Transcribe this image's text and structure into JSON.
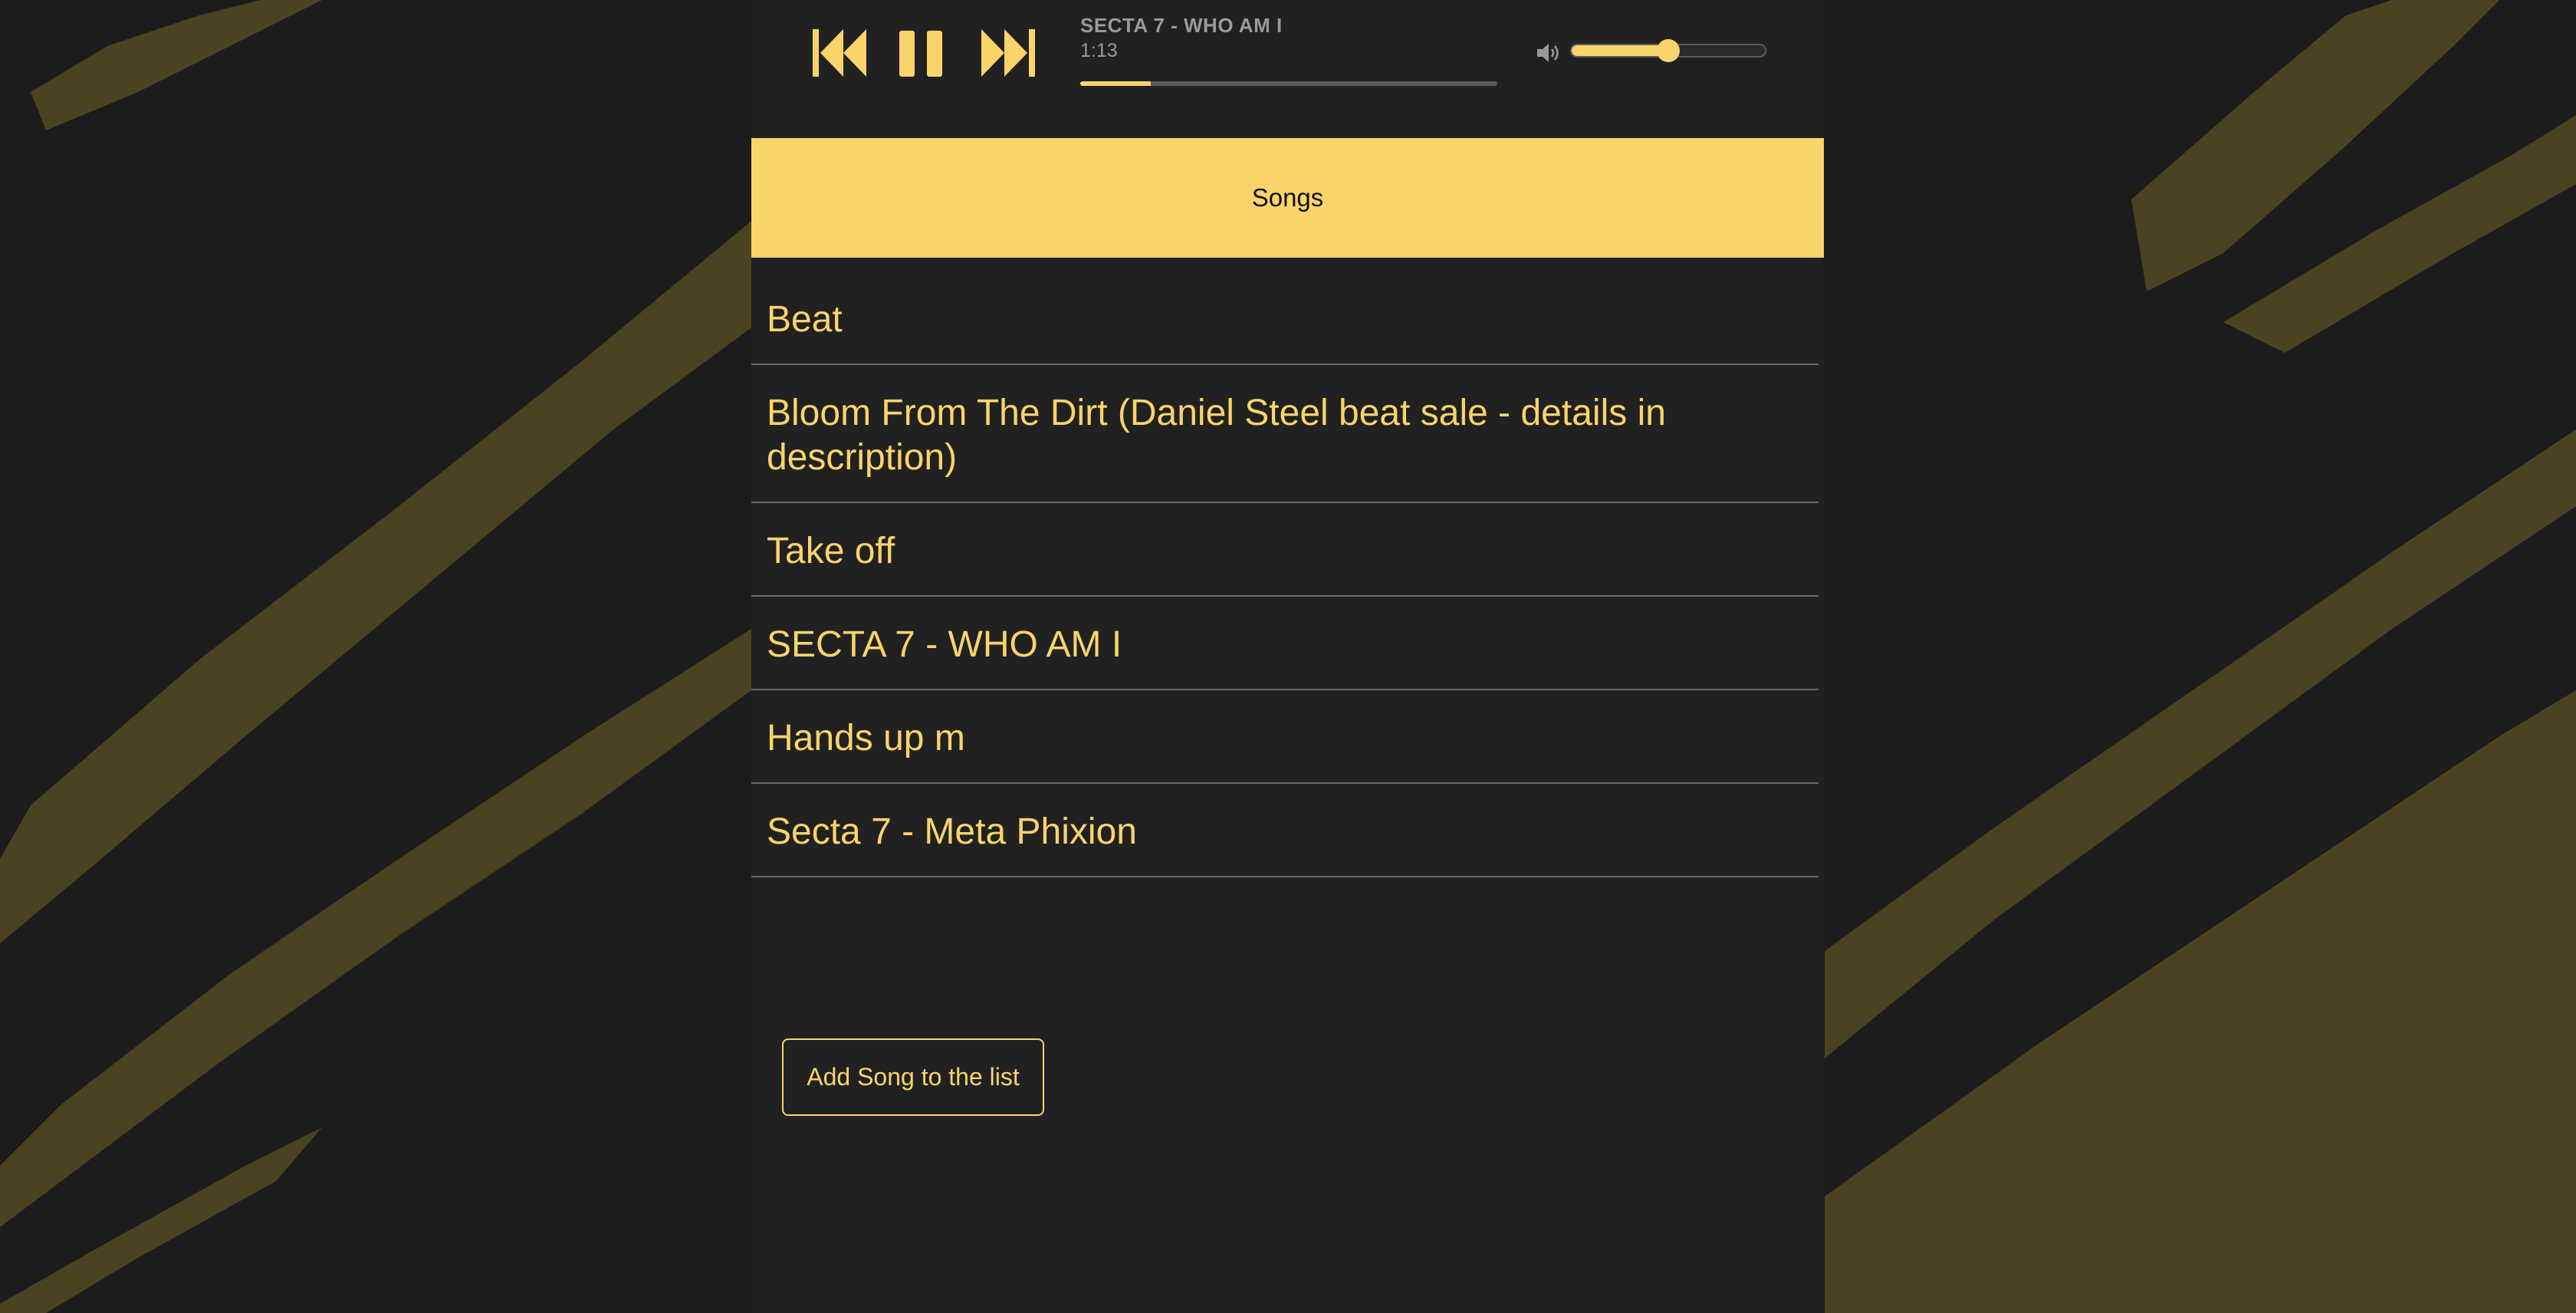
{
  "colors": {
    "accent": "#f9d46b",
    "panel_bg": "#212121",
    "page_bg": "#1f1f1f",
    "brush": "#4a4322",
    "muted_text": "#9a9a9a",
    "divider": "#6a6a6a"
  },
  "player": {
    "prev_icon": "skip-previous-icon",
    "pause_icon": "pause-icon",
    "next_icon": "skip-next-icon",
    "volume_icon": "speaker-icon",
    "now_playing_title": "SECTA 7 - WHO AM I",
    "elapsed_time": "1:13",
    "progress_fraction": 0.17,
    "volume_fraction": 0.5
  },
  "songs_header": {
    "label": "Songs"
  },
  "songs": [
    {
      "title": "Beat"
    },
    {
      "title": "Bloom From The Dirt (Daniel Steel beat sale - details in description)"
    },
    {
      "title": "Take off"
    },
    {
      "title": "SECTA 7 - WHO AM I"
    },
    {
      "title": "Hands up m"
    },
    {
      "title": "Secta 7 - Meta Phixion"
    }
  ],
  "add_song": {
    "label": "Add Song to the list"
  }
}
